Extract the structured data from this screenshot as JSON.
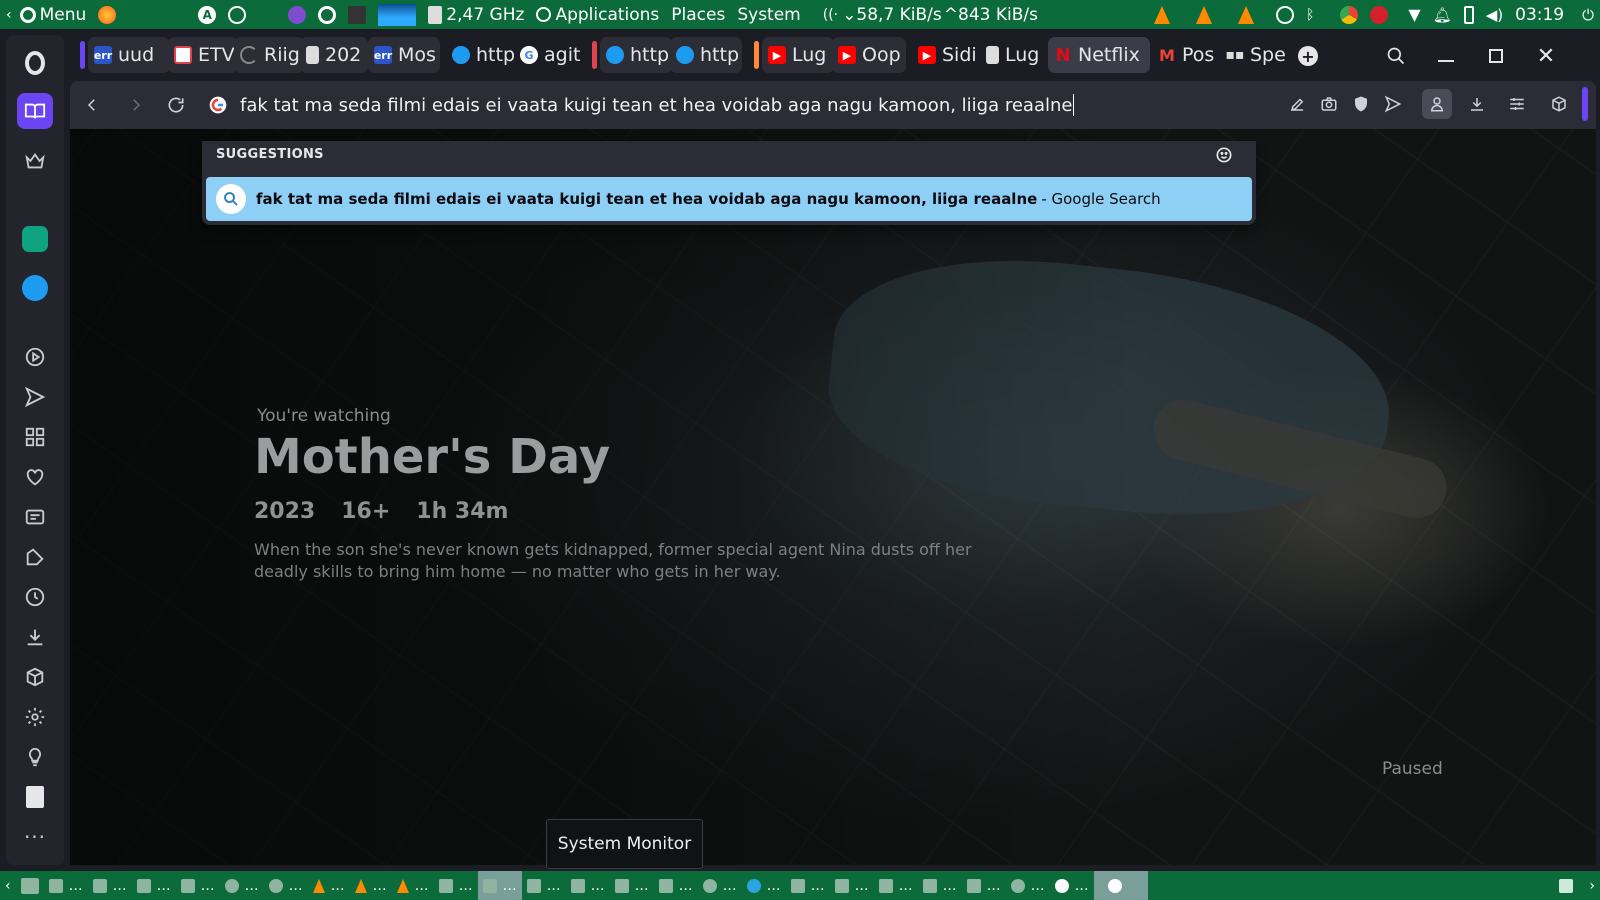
{
  "system_panel": {
    "menu_label": "Menu",
    "cpu_freq": "2,47 GHz",
    "applications_label": "Applications",
    "places_label": "Places",
    "system_label": "System",
    "net_down": "58,7 KiB/s",
    "net_up": "843 KiB/s",
    "clock": "03:19"
  },
  "tabs": [
    {
      "label": "uud",
      "favicon": "err-icon",
      "color": "#2b56c8"
    },
    {
      "label": "ETV",
      "favicon": "etv-icon",
      "color": "#e0434b"
    },
    {
      "label": "Riig",
      "favicon": "loading-icon",
      "color": "#888"
    },
    {
      "label": "202",
      "favicon": "document-icon",
      "color": "#ddd"
    },
    {
      "label": "Mos",
      "favicon": "err-icon",
      "color": "#2b56c8"
    },
    {
      "label": "http",
      "favicon": "twitter-icon",
      "color": "#1d9bf0"
    },
    {
      "label": "agit",
      "favicon": "google-icon",
      "color": "#ffffff"
    },
    {
      "label": "http",
      "favicon": "twitter-icon",
      "color": "#1d9bf0"
    },
    {
      "label": "http",
      "favicon": "twitter-icon",
      "color": "#1d9bf0"
    },
    {
      "label": "Lug",
      "favicon": "youtube-icon",
      "color": "#ff0000"
    },
    {
      "label": "Oop",
      "favicon": "youtube-icon",
      "color": "#ff0000"
    },
    {
      "label": "Sidi",
      "favicon": "youtube-icon",
      "color": "#ff0000"
    },
    {
      "label": "Lug",
      "favicon": "document-icon",
      "color": "#ddd"
    },
    {
      "label": "Netflix",
      "favicon": "netflix-icon",
      "color": "#e50914"
    },
    {
      "label": "Pos",
      "favicon": "gmail-icon",
      "color": "#ea4335"
    },
    {
      "label": "Spe",
      "favicon": "speed-dial-icon",
      "color": "#ddd"
    }
  ],
  "address_bar": {
    "url_text": "fak tat ma seda filmi edais ei vaata kuigi tean et hea voidab aga nagu kamoon, liiga reaalne"
  },
  "suggestions": {
    "heading": "SUGGESTIONS",
    "query": "fak tat ma seda filmi edais ei vaata kuigi tean et hea voidab aga nagu kamoon, liiga reaalne",
    "source": "- Google Search"
  },
  "player": {
    "watching_label": "You're watching",
    "title": "Mother's Day",
    "year": "2023",
    "rating": "16+",
    "duration": "1h 34m",
    "description": "When the son she's never known gets kidnapped, former special agent Nina dusts off her deadly skills to bring him home — no matter who gets in her way.",
    "status": "Paused"
  },
  "tooltip": {
    "label": "System Monitor"
  },
  "taskbar_item_label": "…",
  "colors": {
    "panel_green": "#0b6b3a",
    "suggestion_highlight": "#8ed0f5",
    "opera_accent": "#5b3cf0"
  }
}
